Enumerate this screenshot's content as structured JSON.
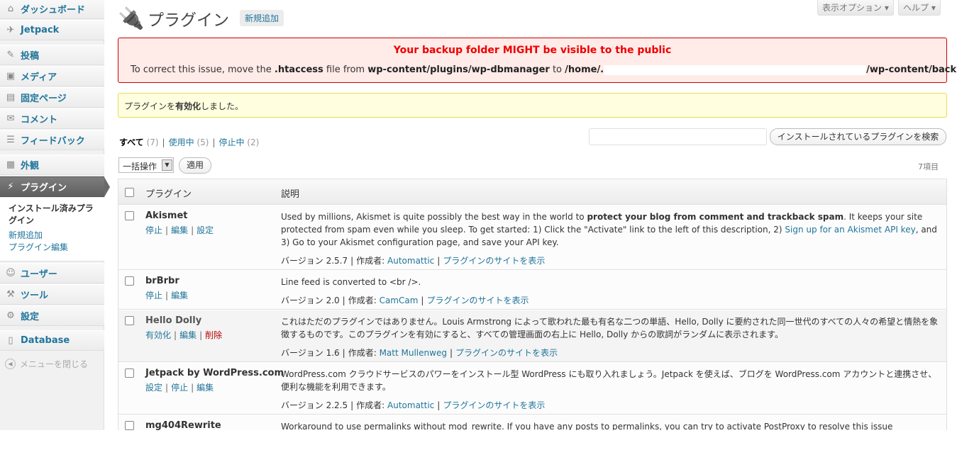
{
  "sidebar": {
    "items": [
      {
        "label": "ダッシュボード",
        "icon": "home-icon",
        "glyph": "⌂"
      },
      {
        "label": "Jetpack",
        "icon": "jetpack-icon",
        "glyph": "✈"
      },
      {
        "label": "投稿",
        "icon": "pin-icon",
        "glyph": "✎"
      },
      {
        "label": "メディア",
        "icon": "media-icon",
        "glyph": "▣"
      },
      {
        "label": "固定ページ",
        "icon": "page-icon",
        "glyph": "▤"
      },
      {
        "label": "コメント",
        "icon": "comment-icon",
        "glyph": "✉"
      },
      {
        "label": "フィードバック",
        "icon": "feedback-icon",
        "glyph": "☰"
      },
      {
        "label": "外観",
        "icon": "appearance-icon",
        "glyph": "▦"
      },
      {
        "label": "プラグイン",
        "icon": "plugin-icon",
        "glyph": "⚡"
      },
      {
        "label": "ユーザー",
        "icon": "users-icon",
        "glyph": "☺"
      },
      {
        "label": "ツール",
        "icon": "tools-icon",
        "glyph": "⚒"
      },
      {
        "label": "設定",
        "icon": "settings-icon",
        "glyph": "⚙"
      },
      {
        "label": "Database",
        "icon": "database-icon",
        "glyph": "▯"
      }
    ],
    "submenu": [
      "インストール済みプラグイン",
      "新規追加",
      "プラグイン編集"
    ],
    "collapse": "メニューを閉じる"
  },
  "header": {
    "title": "プラグイン",
    "add_new": "新規追加",
    "screen_options": "表示オプション ▾",
    "help": "ヘルプ ▾"
  },
  "error": {
    "title": "Your backup folder MIGHT be visible to the public",
    "text1": "To correct this issue, move the ",
    "file": ".htaccess",
    "text2": " file from ",
    "from_path": "wp-content/plugins/wp-dbmanager",
    "text3": " to ",
    "to_path_start": "/home/.",
    "to_path_end": "/wp-content/backup-db"
  },
  "notice": {
    "before": "プラグインを",
    "bold": "有効化",
    "after": "しました。"
  },
  "filters": {
    "all": "すべて",
    "all_count": "(7)",
    "active": "使用中",
    "active_count": "(5)",
    "inactive": "停止中",
    "inactive_count": "(2)"
  },
  "search": {
    "button": "インストールされているプラグインを検索",
    "placeholder": ""
  },
  "bulk": {
    "select": "一括操作",
    "apply": "適用",
    "count": "7項目"
  },
  "table": {
    "col_plugin": "プラグイン",
    "col_desc": "説明",
    "rows": [
      {
        "name": "Akismet",
        "actions": [
          "停止",
          "編集",
          "設定"
        ],
        "desc_pre": "Used by millions, Akismet is quite possibly the best way in the world to ",
        "desc_bold": "protect your blog from comment and trackback spam",
        "desc_mid": ". It keeps your site protected from spam even while you sleep. To get started: 1) Click the \"Activate\" link to the left of this description, 2) ",
        "desc_link": "Sign up for an Akismet API key",
        "desc_post": ", and 3) Go to your Akismet configuration page, and save your API key.",
        "version": "バージョン 2.5.7",
        "author_label": "作成者: ",
        "author": "Automattic",
        "site": "プラグインのサイトを表示"
      },
      {
        "name": "brBrbr",
        "actions": [
          "停止",
          "編集"
        ],
        "desc": "Line feed is converted to <br />.",
        "version": "バージョン 2.0",
        "author_label": "作成者: ",
        "author": "CamCam",
        "site": "プラグインのサイトを表示"
      },
      {
        "name": "Hello Dolly",
        "actions": [
          "有効化",
          "編集",
          "削除"
        ],
        "desc": "これはただのプラグインではありません。Louis Armstrong によって歌われた最も有名な二つの単語、Hello, Dolly に要約された同一世代のすべての人々の希望と情熱を象徴するものです。このプラグインを有効にすると、すべての管理画面の右上に Hello, Dolly からの歌詞がランダムに表示されます。",
        "version": "バージョン 1.6",
        "author_label": "作成者: ",
        "author": "Matt Mullenweg",
        "site": "プラグインのサイトを表示"
      },
      {
        "name": "Jetpack by WordPress.com",
        "actions": [
          "設定",
          "停止",
          "編集"
        ],
        "desc": "WordPress.com クラウドサービスのパワーをインストール型 WordPress にも取り入れましょう。Jetpack を使えば、ブログを WordPress.com アカウントと連携させ、便利な機能を利用できます。",
        "version": "バージョン 2.2.5",
        "author_label": "作成者: ",
        "author": "Automattic",
        "site": "プラグインのサイトを表示"
      },
      {
        "name": "mg404Rewrite",
        "desc": "Workaround to use permalinks without mod_rewrite. If you have any posts to permalinks, you can try to activate PostProxy to resolve this issue"
      }
    ]
  }
}
